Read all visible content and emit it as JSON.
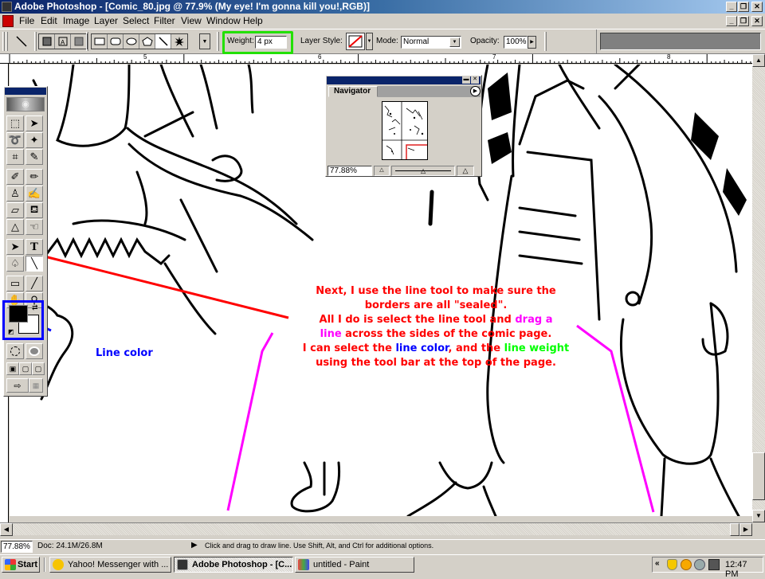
{
  "window": {
    "title": "Adobe Photoshop - [Comic_80.jpg @ 77.9% (My eye! I'm gonna kill you!,RGB)]",
    "controls": {
      "minimize": "_",
      "restore": "❐",
      "close": "✕"
    }
  },
  "menubar": {
    "items": [
      "File",
      "Edit",
      "Image",
      "Layer",
      "Select",
      "Filter",
      "View",
      "Window",
      "Help"
    ]
  },
  "options_bar": {
    "current_tool_icon": "line-tool-icon",
    "path_modes": [
      "shape-layers-icon",
      "paths-icon",
      "fill-pixels-icon"
    ],
    "shape_tools": [
      "rectangle-icon",
      "rounded-rectangle-icon",
      "ellipse-icon",
      "polygon-icon",
      "line-icon",
      "custom-shape-icon"
    ],
    "selected_shape_tool": "line-icon",
    "weight_label": "Weight:",
    "weight_value": "4 px",
    "layer_style_label": "Layer Style:",
    "mode_label": "Mode:",
    "mode_value": "Normal",
    "opacity_label": "Opacity:",
    "opacity_value": "100%"
  },
  "ruler": {
    "ticks": [
      "5",
      "6",
      "7",
      "8"
    ]
  },
  "toolbox": {
    "tools": [
      [
        "rectangular-marquee-icon",
        "move-icon"
      ],
      [
        "lasso-icon",
        "magic-wand-icon"
      ],
      [
        "crop-icon",
        "slice-icon"
      ],
      [
        "healing-brush-icon",
        "pencil-icon"
      ],
      [
        "clone-stamp-icon",
        "history-brush-icon"
      ],
      [
        "eraser-icon",
        "paint-bucket-icon"
      ],
      [
        "sharpen-icon",
        "smudge-icon"
      ],
      [
        "path-selection-icon",
        "type-icon"
      ],
      [
        "pen-icon",
        "line-tool-icon"
      ],
      [
        "notes-icon",
        "eyedropper-icon"
      ],
      [
        "hand-icon",
        "zoom-icon"
      ]
    ],
    "glyphs": {
      "rectangular-marquee-icon": "⬚",
      "move-icon": "➤",
      "lasso-icon": "➰",
      "magic-wand-icon": "✦",
      "crop-icon": "⌗",
      "slice-icon": "✎",
      "healing-brush-icon": "✐",
      "pencil-icon": "✏",
      "clone-stamp-icon": "♙",
      "history-brush-icon": "✍",
      "eraser-icon": "▱",
      "paint-bucket-icon": "⛾",
      "sharpen-icon": "△",
      "smudge-icon": "☜",
      "path-selection-icon": "➤",
      "type-icon": "T",
      "pen-icon": "♤",
      "line-tool-icon": "╲",
      "notes-icon": "▭",
      "eyedropper-icon": "╱",
      "hand-icon": "✋",
      "zoom-icon": "⚲"
    },
    "selected_tool": "line-tool-icon",
    "foreground_color": "#000000",
    "background_color": "#ffffff"
  },
  "navigator": {
    "title": "Navigator",
    "zoom_value": "77.88%",
    "zoom_slider_fraction": 0.5
  },
  "annotations": {
    "main_lines": [
      [
        {
          "text": "Next, I use the line tool to make sure the",
          "color": "#ff0000"
        }
      ],
      [
        {
          "text": "borders are all \"sealed\".",
          "color": "#ff0000"
        }
      ],
      [
        {
          "text": "All I do is select the line tool and ",
          "color": "#ff0000"
        },
        {
          "text": "drag a",
          "color": "#ff00ff"
        }
      ],
      [
        {
          "text": "line",
          "color": "#ff00ff"
        },
        {
          "text": " across the sides of the comic page.",
          "color": "#ff0000"
        }
      ],
      [
        {
          "text": "I can select the ",
          "color": "#ff0000"
        },
        {
          "text": "line color",
          "color": "#0000ff"
        },
        {
          "text": ", and the ",
          "color": "#ff0000"
        },
        {
          "text": "line weight",
          "color": "#00ff00"
        }
      ],
      [
        {
          "text": "using the tool bar at the top of the page.",
          "color": "#ff0000"
        }
      ]
    ],
    "line_color_label": "Line color",
    "colors": {
      "red": "#ff0000",
      "magenta": "#ff00ff",
      "blue": "#0000ff",
      "green": "#00ff00"
    }
  },
  "statusbar": {
    "zoom": "77.88%",
    "doc_size": "Doc: 24.1M/26.8M",
    "hint": "Click and drag to draw line.  Use Shift, Alt, and Ctrl for additional options."
  },
  "taskbar": {
    "start_label": "Start",
    "tasks": [
      {
        "label": "Yahoo! Messenger with ...",
        "icon": "yahoo-messenger-icon",
        "active": false
      },
      {
        "label": "Adobe Photoshop - [C...",
        "icon": "photoshop-icon",
        "active": true
      },
      {
        "label": "untitled - Paint",
        "icon": "paint-icon",
        "active": false
      }
    ],
    "tray_icons": [
      "show-hidden-icon",
      "security-shield-icon",
      "yahoo-tray-icon",
      "speaker-icon",
      "app-tray-icon"
    ],
    "clock": "12:47 PM"
  }
}
